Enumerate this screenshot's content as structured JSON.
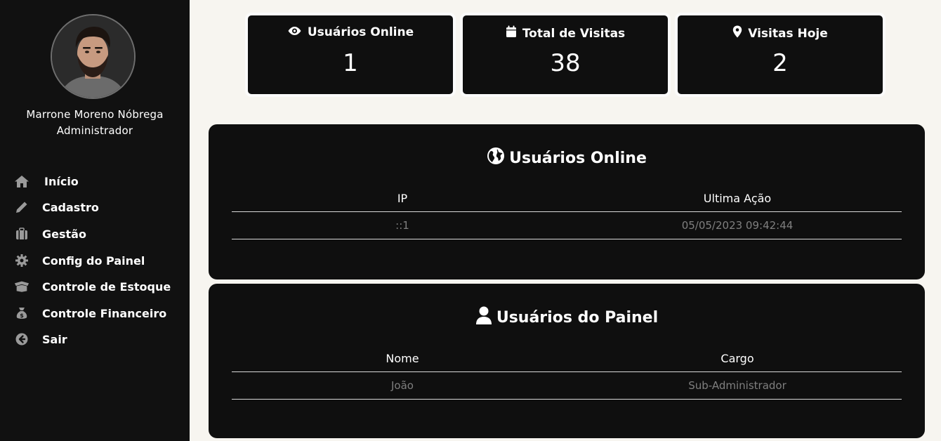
{
  "sidebar": {
    "user_name": "Marrone Moreno Nóbrega",
    "user_role": "Administrador",
    "menu": [
      {
        "label": "Início",
        "icon": "home-icon"
      },
      {
        "label": "Cadastro",
        "icon": "pencil-icon"
      },
      {
        "label": "Gestão",
        "icon": "briefcase-icon"
      },
      {
        "label": "Config do Painel",
        "icon": "gear-icon"
      },
      {
        "label": "Controle de Estoque",
        "icon": "box-icon"
      },
      {
        "label": "Controle Financeiro",
        "icon": "money-bag-icon"
      },
      {
        "label": "Sair",
        "icon": "arrow-left-circle-icon"
      }
    ]
  },
  "stats": [
    {
      "title": "Usuários Online",
      "value": "1",
      "icon": "eye-icon"
    },
    {
      "title": "Total de Visitas",
      "value": "38",
      "icon": "calendar-icon"
    },
    {
      "title": "Visitas Hoje",
      "value": "2",
      "icon": "map-pin-icon"
    }
  ],
  "online_panel": {
    "title": "Usuários Online",
    "icon": "globe-icon",
    "columns": [
      "IP",
      "Ultima Ação"
    ],
    "rows": [
      [
        "::1",
        "05/05/2023 09:42:44"
      ]
    ]
  },
  "users_panel": {
    "title": "Usuários do Painel",
    "icon": "user-icon",
    "columns": [
      "Nome",
      "Cargo"
    ],
    "rows": [
      [
        "João",
        "Sub-Administrador"
      ]
    ]
  },
  "colors": {
    "sidebar_bg": "#111111",
    "page_bg": "#f7f5f0",
    "card_bg": "#0f0f0f",
    "muted_text": "#7f7f7f",
    "icon_gray": "#9a9a9a"
  }
}
